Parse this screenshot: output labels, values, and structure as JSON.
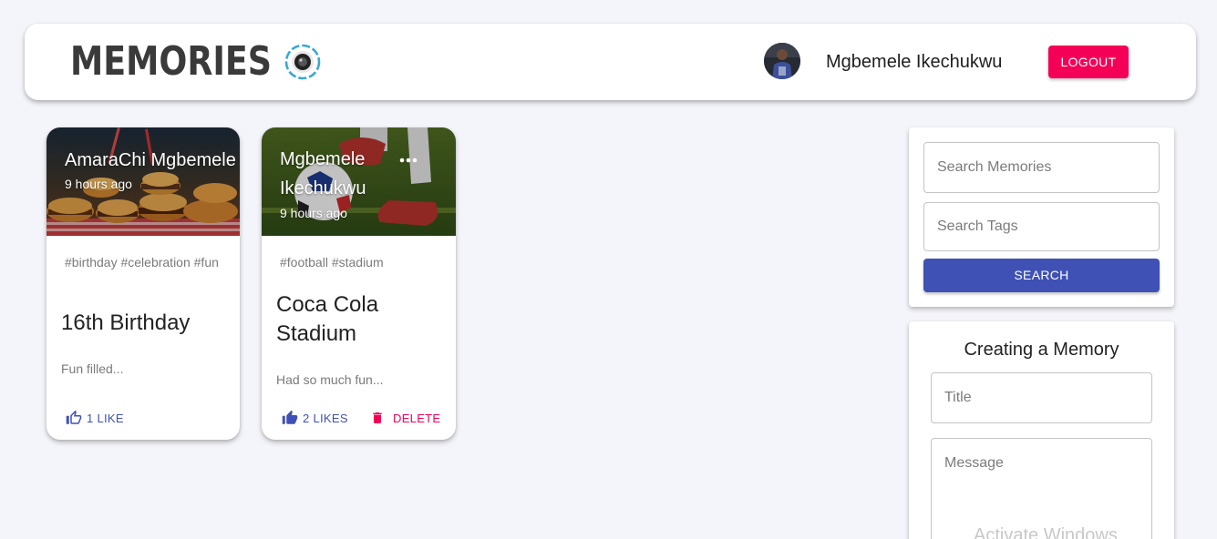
{
  "header": {
    "brand": "MEMORIES",
    "user_name": "Mgbemele Ikechukwu",
    "logout_label": "LOGOUT"
  },
  "posts": [
    {
      "creator": "AmaraChi Mgbemele",
      "time": "9 hours ago",
      "tags": "#birthday #celebration #fun",
      "title": "16th Birthday",
      "message": "Fun filled...",
      "likes_label": "1 LIKE",
      "image_icon": "burgers-photo"
    },
    {
      "creator": "Mgbemele Ikechukwu",
      "time": "9 hours ago",
      "tags": "#football #stadium",
      "title": "Coca Cola Stadium",
      "message": "Had so much fun...",
      "likes_label": "2 LIKES",
      "delete_label": "DELETE",
      "image_icon": "football-photo"
    }
  ],
  "search": {
    "memories_placeholder": "Search Memories",
    "tags_placeholder": "Search Tags",
    "button_label": "SEARCH"
  },
  "form": {
    "heading": "Creating a Memory",
    "title_placeholder": "Title",
    "message_placeholder": "Message"
  },
  "watermark": "Activate Windows",
  "colors": {
    "primary": "#3f51b5",
    "secondary": "#f50057",
    "background": "#f4f5fa"
  }
}
